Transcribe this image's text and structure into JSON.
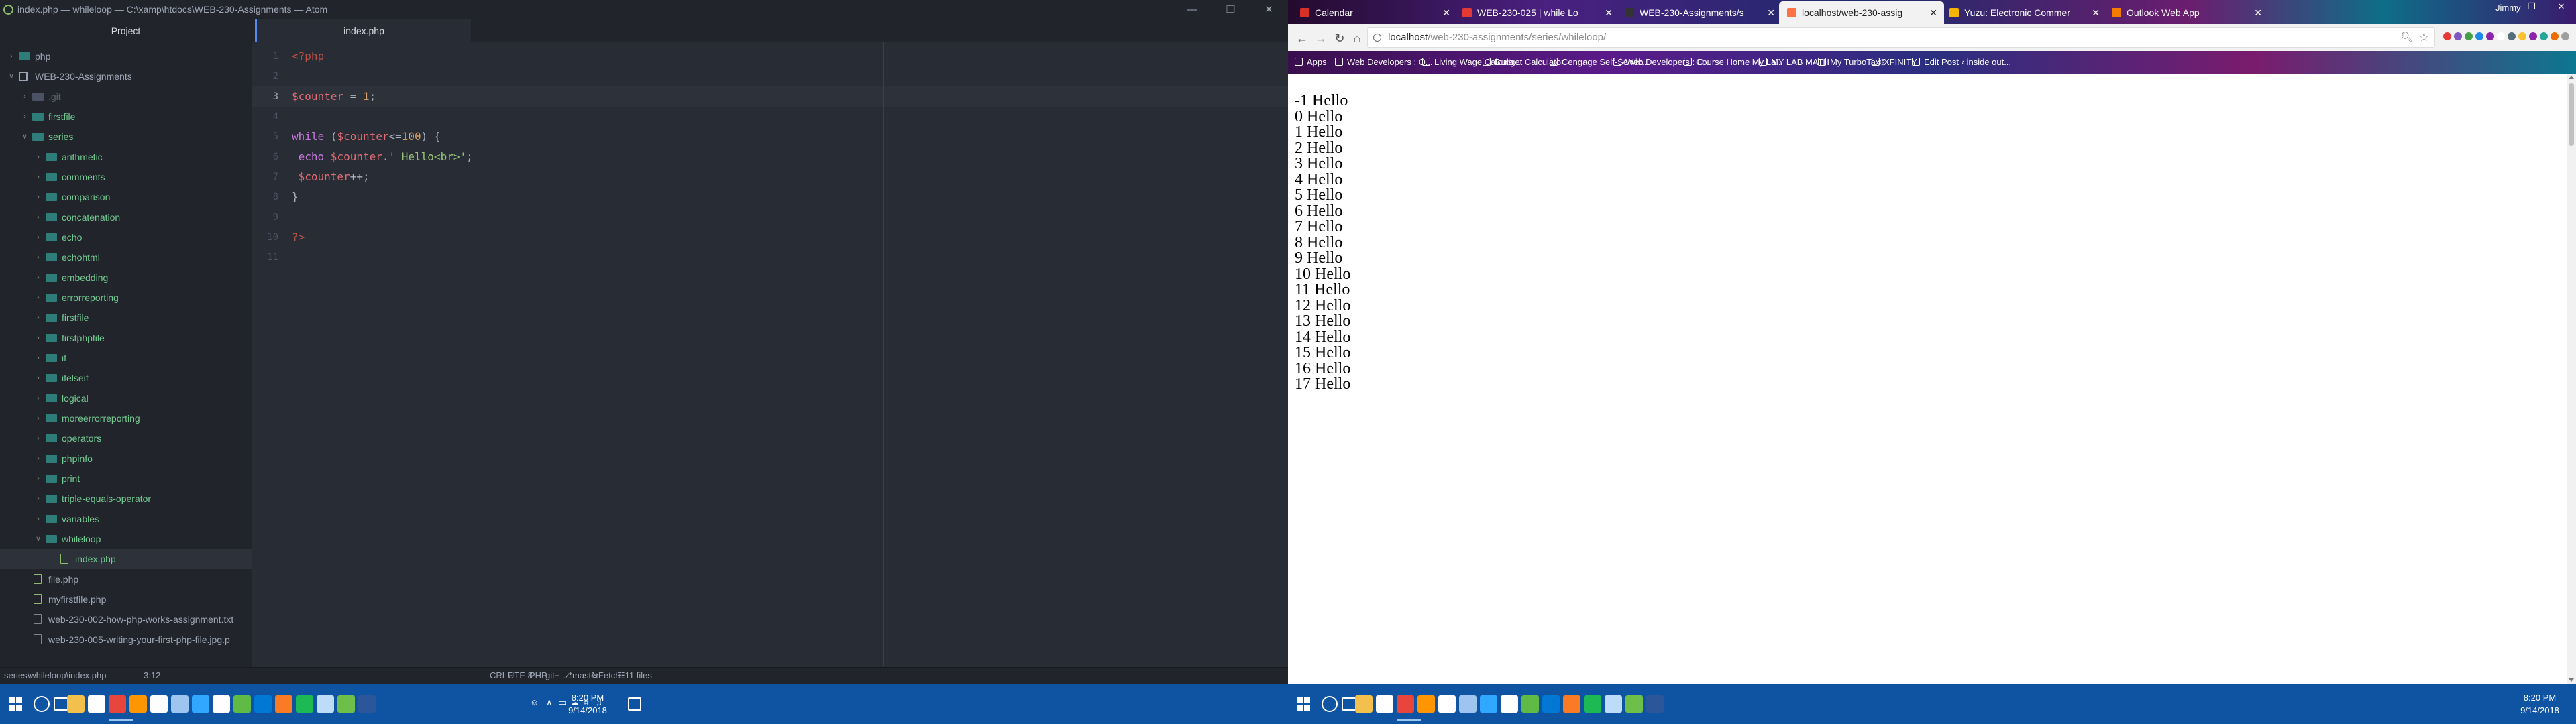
{
  "atom": {
    "window_title": "index.php — whileloop — C:\\xamp\\htdocs\\WEB-230-Assignments — Atom",
    "tree_header": "Project",
    "tree": [
      {
        "label": "php",
        "depth": 0,
        "type": "folder",
        "expanded": false
      },
      {
        "label": "WEB-230-Assignments",
        "depth": 0,
        "type": "repo",
        "expanded": true
      },
      {
        "label": ".git",
        "depth": 1,
        "type": "folder",
        "expanded": false,
        "muted": true
      },
      {
        "label": "firstfile",
        "depth": 1,
        "type": "folder",
        "expanded": false
      },
      {
        "label": "series",
        "depth": 1,
        "type": "folder",
        "expanded": true
      },
      {
        "label": "arithmetic",
        "depth": 2,
        "type": "folder",
        "expanded": false
      },
      {
        "label": "comments",
        "depth": 2,
        "type": "folder",
        "expanded": false
      },
      {
        "label": "comparison",
        "depth": 2,
        "type": "folder",
        "expanded": false
      },
      {
        "label": "concatenation",
        "depth": 2,
        "type": "folder",
        "expanded": false
      },
      {
        "label": "echo",
        "depth": 2,
        "type": "folder",
        "expanded": false
      },
      {
        "label": "echohtml",
        "depth": 2,
        "type": "folder",
        "expanded": false
      },
      {
        "label": "embedding",
        "depth": 2,
        "type": "folder",
        "expanded": false
      },
      {
        "label": "errorreporting",
        "depth": 2,
        "type": "folder",
        "expanded": false
      },
      {
        "label": "firstfile",
        "depth": 2,
        "type": "folder",
        "expanded": false
      },
      {
        "label": "firstphpfile",
        "depth": 2,
        "type": "folder",
        "expanded": false
      },
      {
        "label": "if",
        "depth": 2,
        "type": "folder",
        "expanded": false
      },
      {
        "label": "ifelseif",
        "depth": 2,
        "type": "folder",
        "expanded": false
      },
      {
        "label": "logical",
        "depth": 2,
        "type": "folder",
        "expanded": false
      },
      {
        "label": "moreerrorreporting",
        "depth": 2,
        "type": "folder",
        "expanded": false
      },
      {
        "label": "operators",
        "depth": 2,
        "type": "folder",
        "expanded": false
      },
      {
        "label": "phpinfo",
        "depth": 2,
        "type": "folder",
        "expanded": false
      },
      {
        "label": "print",
        "depth": 2,
        "type": "folder",
        "expanded": false
      },
      {
        "label": "triple-equals-operator",
        "depth": 2,
        "type": "folder",
        "expanded": false
      },
      {
        "label": "variables",
        "depth": 2,
        "type": "folder",
        "expanded": false
      },
      {
        "label": "whileloop",
        "depth": 2,
        "type": "folder",
        "expanded": true
      },
      {
        "label": "index.php",
        "depth": 3,
        "type": "file",
        "selected": true
      },
      {
        "label": "file.php",
        "depth": 1,
        "type": "file"
      },
      {
        "label": "myfirstfile.php",
        "depth": 1,
        "type": "file"
      },
      {
        "label": "web-230-002-how-php-works-assignment.txt",
        "depth": 1,
        "type": "file"
      },
      {
        "label": "web-230-005-writing-your-first-php-file.jpg.p",
        "depth": 1,
        "type": "file"
      }
    ],
    "tab_title": "index.php",
    "line_numbers": [
      "1",
      "2",
      "3",
      "4",
      "5",
      "6",
      "7",
      "8",
      "9",
      "10",
      "11"
    ],
    "code_lines": [
      [
        {
          "t": "<?php",
          "c": "tg"
        }
      ],
      [],
      [
        {
          "t": "$counter",
          "c": "v"
        },
        {
          "t": " = ",
          "c": "p"
        },
        {
          "t": "1",
          "c": "n"
        },
        {
          "t": ";",
          "c": "p"
        }
      ],
      [],
      [
        {
          "t": "while",
          "c": "k"
        },
        {
          "t": " (",
          "c": "p"
        },
        {
          "t": "$counter",
          "c": "v"
        },
        {
          "t": "<=",
          "c": "p"
        },
        {
          "t": "100",
          "c": "n"
        },
        {
          "t": ") {",
          "c": "p"
        }
      ],
      [
        {
          "t": " echo ",
          "c": "k"
        },
        {
          "t": "$counter",
          "c": "v"
        },
        {
          "t": ".",
          "c": "p"
        },
        {
          "t": "' Hello<br>'",
          "c": "s"
        },
        {
          "t": ";",
          "c": "p"
        }
      ],
      [
        {
          "t": " $counter",
          "c": "v"
        },
        {
          "t": "++;",
          "c": "p"
        }
      ],
      [
        {
          "t": "}",
          "c": "p"
        }
      ],
      [],
      [
        {
          "t": "?>",
          "c": "tg"
        }
      ],
      []
    ],
    "status": {
      "path": "series\\whileloop\\index.php",
      "cursor": "3:12",
      "line_ending": "CRLF",
      "encoding": "UTF-8",
      "grammar": "PHP",
      "git": "git+",
      "branch": "master",
      "fetch": "Fetch",
      "files": "11 files"
    }
  },
  "chrome": {
    "tabs": [
      {
        "title": "Calendar",
        "favicon_color": "#d93025"
      },
      {
        "title": "WEB-230-025 | while Lo",
        "favicon_color": "#e53935"
      },
      {
        "title": "WEB-230-Assignments/s",
        "favicon_color": "#333333"
      },
      {
        "title": "localhost/web-230-assig",
        "favicon_color": "#ff7043",
        "active": true
      },
      {
        "title": "Yuzu: Electronic Commer",
        "favicon_color": "#f4b400"
      },
      {
        "title": "Outlook Web App",
        "favicon_color": "#f57c00"
      }
    ],
    "user": "Jimmy",
    "url_host": "localhost",
    "url_path": "/web-230-assignments/series/whileloop/",
    "bookmarks": [
      "Apps",
      "Web Developers : O...",
      "Living Wage Calcula...",
      "Budget Calculator",
      "Cengage Self-Servic...",
      "Web Developers : O...",
      "Course Home My La...",
      "MY LAB MATH",
      "My TurboTax®",
      "XFINITY",
      "Edit Post ‹ inside out..."
    ],
    "output_lines": [
      "-1 Hello",
      "0 Hello",
      "1 Hello",
      "2 Hello",
      "3 Hello",
      "4 Hello",
      "5 Hello",
      "6 Hello",
      "7 Hello",
      "8 Hello",
      "9 Hello",
      "10 Hello",
      "11 Hello",
      "12 Hello",
      "13 Hello",
      "14 Hello",
      "15 Hello",
      "16 Hello",
      "17 Hello"
    ]
  },
  "taskbar": {
    "time": "8:20 PM",
    "date": "9/14/2018",
    "icons": [
      "file-explorer-icon",
      "store-icon",
      "chrome-icon",
      "firefox-icon",
      "mail-icon",
      "notepad-icon",
      "photoshop-icon",
      "media-icon",
      "dreamweaver-icon",
      "outlook-icon",
      "xampp-icon",
      "spotify-icon",
      "paint-icon",
      "keepass-icon",
      "word-icon"
    ],
    "icon_colors": [
      "#f3c04d",
      "#ffffff",
      "#e8453c",
      "#ff9500",
      "#ffffff",
      "#9ec5f0",
      "#31a8ff",
      "#ffffff",
      "#5fba46",
      "#0078d4",
      "#fb7a24",
      "#1db954",
      "#bcdcf7",
      "#6dbf4a",
      "#2b579a"
    ]
  }
}
